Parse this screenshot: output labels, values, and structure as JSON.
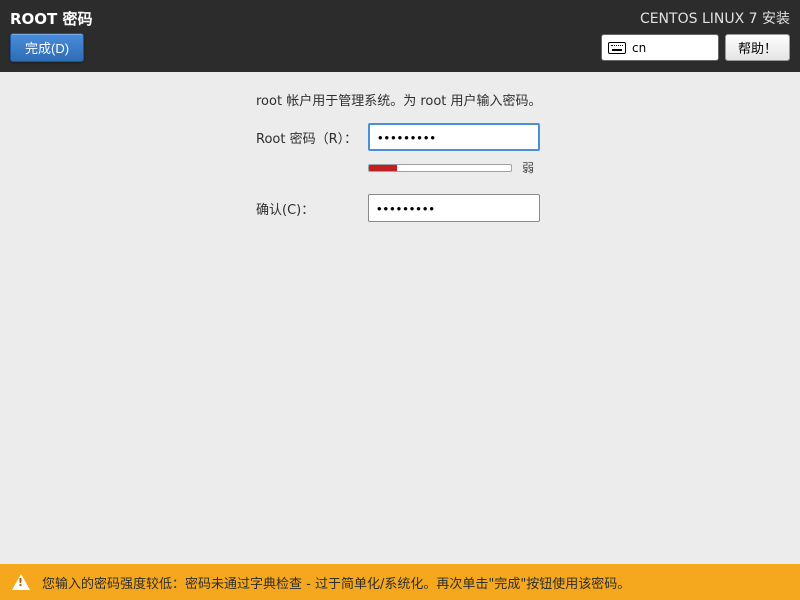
{
  "header": {
    "title": "ROOT 密码",
    "done_label": "完成(D)",
    "installer_title": "CENTOS LINUX 7 安装",
    "lang_code": "cn",
    "help_label": "帮助！"
  },
  "form": {
    "description": "root 帐户用于管理系统。为 root 用户输入密码。",
    "password_label": "Root 密码（R）：",
    "password_value": "•••••••••",
    "confirm_label": "确认(C)：",
    "confirm_value": "•••••••••",
    "strength_label": "弱",
    "strength_percent": 20
  },
  "warning": {
    "message": "您输入的密码强度较低：密码未通过字典检查 - 过于简单化/系统化。再次单击\"完成\"按钮使用该密码。"
  }
}
